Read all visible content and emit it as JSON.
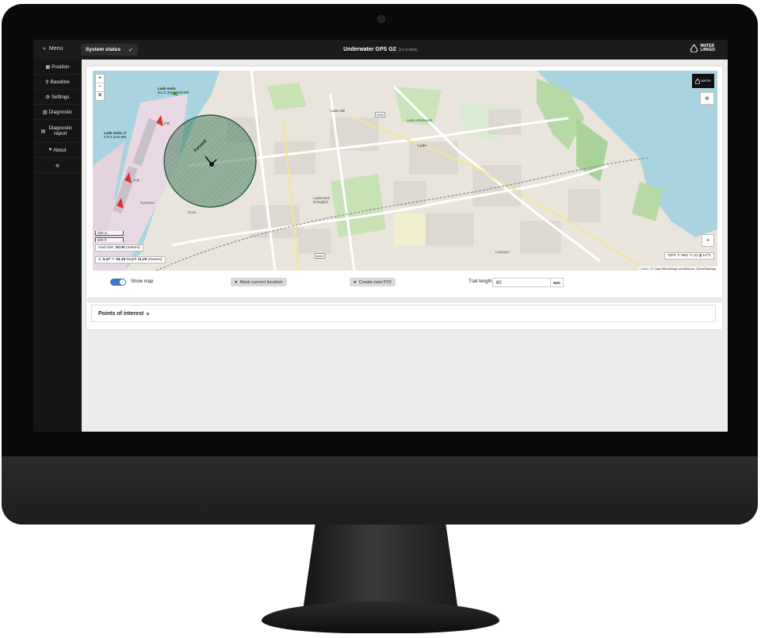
{
  "topbar": {
    "menu_label": "Menu",
    "status_label": "System status",
    "title": "Underwater GPS G2",
    "version": "(3.2.0.9300)",
    "brand_line1": "WATER",
    "brand_line2": "LINKED"
  },
  "sidebar": {
    "items": [
      {
        "icon": "map-icon",
        "label": "Position"
      },
      {
        "icon": "pin-icon",
        "label": "Baseline"
      },
      {
        "icon": "gears-icon",
        "label": "Settings"
      },
      {
        "icon": "chart-icon",
        "label": "Diagnostic"
      },
      {
        "icon": "calendar-icon",
        "label": "Diagnostic report"
      },
      {
        "icon": "heart-icon",
        "label": "About"
      }
    ],
    "collapse_label": "«"
  },
  "map": {
    "zoom_in": "+",
    "zoom_out": "−",
    "fullscreen": "✕",
    "scale_m": "200 m",
    "scale_ft": "500 ft",
    "grid_size_label": "Grid size:",
    "grid_size_value": "20.00",
    "grid_size_unit": "(meters)",
    "pos_x_label": "X:",
    "pos_x": "6.47",
    "pos_y_label": "Y:",
    "pos_y": "34.15",
    "depth_label": "Depth",
    "depth": "11.29",
    "depth_unit": "(meters)",
    "forward_label": "Forward",
    "labels": {
      "lade_molo": "Lade molo",
      "lade_molo_sub": "Iso.G.3s10.5m0.6M",
      "lade_molo_v": "Lade molo, V",
      "lade_molo_v_sub": "F.R.5.1m0.9M",
      "fr1": "F.R",
      "fr2": "F.R",
      "lade_alle": "Lade allé",
      "lade_idrettspark": "Lade idrettspark",
      "lade": "Lade",
      "lademoen_kirkegard": "Lademoen kirkegård",
      "lade_gaard": "Leangen",
      "dora": "Dora",
      "road_6682": "6682",
      "road_6688": "6688",
      "trondheim": "Nyhavna"
    },
    "sensor_gps": "GPS",
    "sensor_imu": "IMU",
    "sensor_u1": "U1",
    "sensor_temp": "14°C",
    "attrib_leaflet": "Leaflet",
    "attrib_rest": " | © OpenStreetMap contributors, OpenSeamap"
  },
  "controls": {
    "show_map_label": "Show map",
    "mark_location_label": "Mark current location",
    "create_poi_label": "Create new POI",
    "trail_length_label": "Trail length",
    "trail_length_value": "60",
    "trail_length_unit": "sec"
  },
  "poi": {
    "title": "Points of interest",
    "chevron": "»"
  }
}
